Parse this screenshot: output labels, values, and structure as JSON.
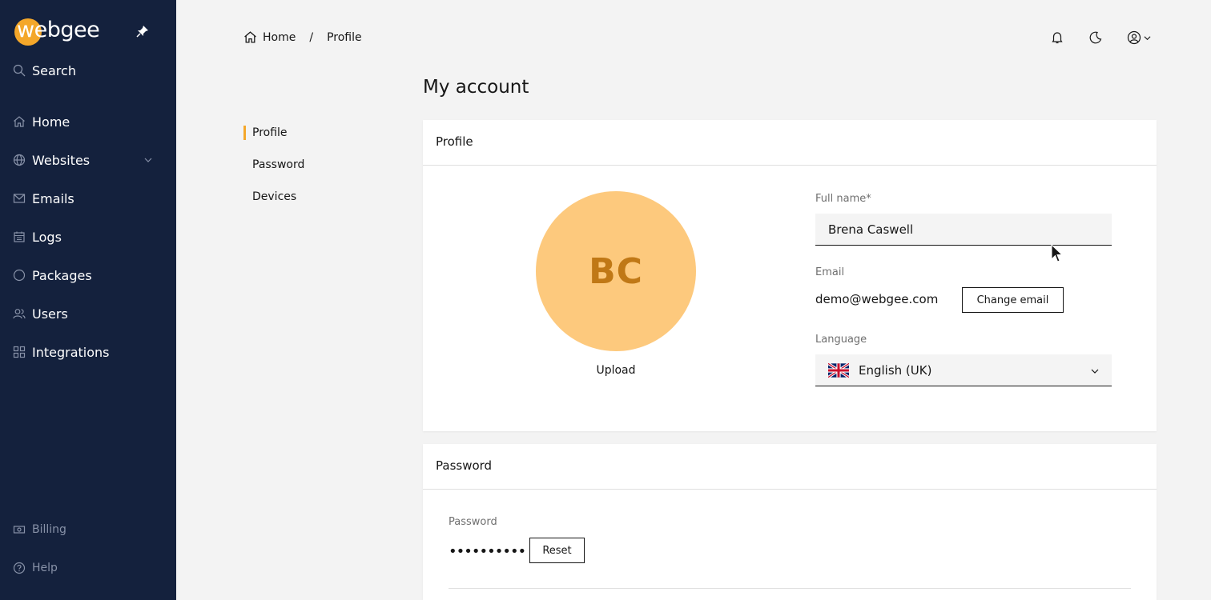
{
  "app": {
    "logo_text": "webgee"
  },
  "sidebar": {
    "search_label": "Search",
    "items": [
      {
        "label": "Home",
        "icon": "home-icon"
      },
      {
        "label": "Websites",
        "icon": "globe-icon"
      },
      {
        "label": "Emails",
        "icon": "mail-icon"
      },
      {
        "label": "Logs",
        "icon": "calendar-icon"
      },
      {
        "label": "Packages",
        "icon": "circle-icon"
      },
      {
        "label": "Users",
        "icon": "users-icon"
      },
      {
        "label": "Integrations",
        "icon": "grid-icon"
      }
    ],
    "footer": [
      {
        "label": "Billing",
        "icon": "money-icon"
      },
      {
        "label": "Help",
        "icon": "help-icon"
      }
    ]
  },
  "breadcrumb": {
    "home": "Home",
    "separator": "/",
    "current": "Profile"
  },
  "page": {
    "title": "My account"
  },
  "subnav": {
    "profile": "Profile",
    "password": "Password",
    "devices": "Devices"
  },
  "profile_card": {
    "heading": "Profile",
    "initials": "BC",
    "upload_label": "Upload",
    "full_name_label": "Full name*",
    "full_name_value": "Brena Caswell",
    "email_label": "Email",
    "email_value": "demo@webgee.com",
    "change_email_label": "Change email",
    "language_label": "Language",
    "language_value": "English (UK)"
  },
  "password_card": {
    "heading": "Password",
    "password_label": "Password",
    "password_value": "••••••••••",
    "reset_label": "Reset"
  },
  "colors": {
    "sidebar": "#14213d",
    "accent": "#f4a72a",
    "avatar_bg": "#fdc97d",
    "avatar_text": "#c07816"
  }
}
